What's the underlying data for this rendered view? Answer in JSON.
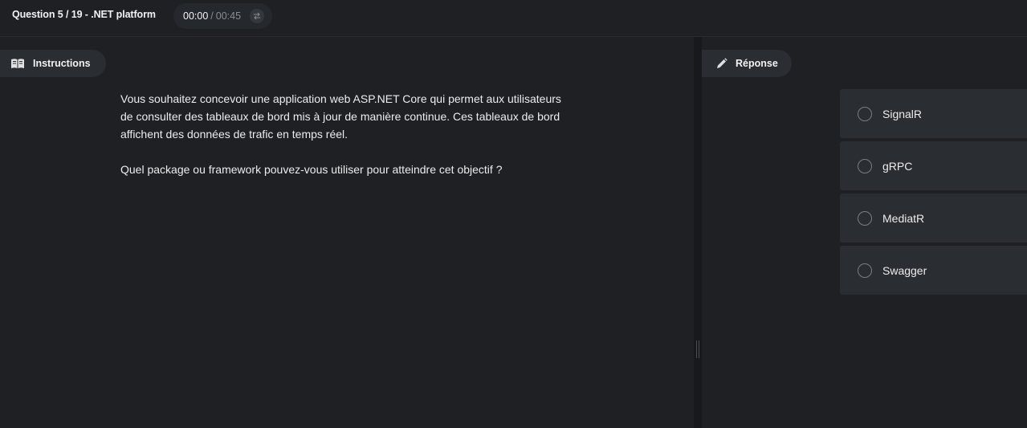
{
  "header": {
    "question_label": "Question 5 / 19 - .NET platform",
    "timer": {
      "elapsed": "00:00",
      "separator": "/",
      "total": "00:45",
      "icon": "swap-arrows-icon"
    }
  },
  "instructions": {
    "label": "Instructions",
    "icon": "book-icon",
    "paragraphs": [
      "Vous souhaitez concevoir une application web ASP.NET Core qui permet aux utilisateurs de consulter des tableaux de bord mis à jour de manière continue. Ces tableaux de bord affichent des données de trafic en temps réel.",
      "Quel package ou framework pouvez-vous utiliser pour atteindre cet objectif ?"
    ]
  },
  "answer": {
    "label": "Réponse",
    "icon": "pencil-icon",
    "options": [
      {
        "label": "SignalR",
        "selected": false
      },
      {
        "label": "gRPC",
        "selected": false
      },
      {
        "label": "MediatR",
        "selected": false
      },
      {
        "label": "Swagger",
        "selected": false
      }
    ]
  },
  "colors": {
    "background": "#1e2023",
    "panel": "#2a2d31",
    "text": "#ececec",
    "muted": "#8a8d92"
  }
}
